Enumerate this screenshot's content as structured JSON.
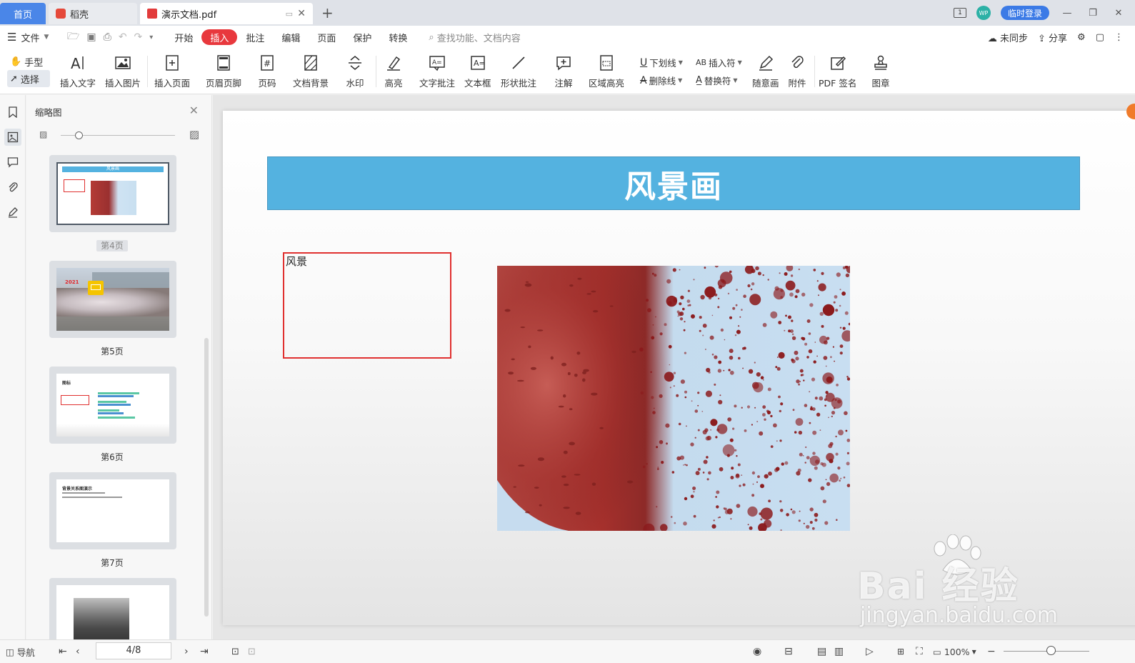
{
  "tabs": {
    "home": "首页",
    "daoke": "稻壳",
    "document": "演示文档.pdf",
    "new_tab": "+",
    "login": "临时登录",
    "avatar_text": "WP",
    "layout_icon_text": "1"
  },
  "menu": {
    "file": "文件",
    "items": [
      "开始",
      "插入",
      "批注",
      "编辑",
      "页面",
      "保护",
      "转换"
    ],
    "active": "插入",
    "search_placeholder": "查找功能、文档内容",
    "sync": "未同步",
    "share": "分享"
  },
  "ribbon": {
    "hand": "手型",
    "select": "选择",
    "insert_text": "插入文字",
    "insert_image": "插入图片",
    "insert_page": "插入页面",
    "header_footer": "页眉页脚",
    "page_number": "页码",
    "doc_background": "文档背景",
    "watermark": "水印",
    "highlight": "高亮",
    "text_comment": "文字批注",
    "text_box": "文本框",
    "shape_comment": "形状批注",
    "annotation": "注解",
    "area_highlight": "区域高亮",
    "underline": "下划线",
    "strikethrough": "删除线",
    "insert_symbol": "插入符",
    "replace_symbol": "替换符",
    "freehand": "随意画",
    "attachment": "附件",
    "pdf_sign": "PDF 签名",
    "stamp": "图章"
  },
  "thumbnails": {
    "title": "缩略图",
    "pages": [
      {
        "label": "第4页",
        "current": true
      },
      {
        "label": "第5页",
        "current": false
      },
      {
        "label": "第6页",
        "current": false
      },
      {
        "label": "第7页",
        "current": false
      }
    ],
    "page5_year": "2021",
    "page6_title": "图标",
    "page7_title": "背景关系图演示",
    "page4_banner": "风景画"
  },
  "document": {
    "banner_title": "风景画",
    "text_box_content": "风景"
  },
  "statusbar": {
    "nav": "导航",
    "page_indicator": "4/8",
    "zoom": "100%"
  },
  "watermark": {
    "brand": "Bai 经验",
    "url": "jingyan.baidu.com"
  },
  "colors": {
    "active_tab": "#e8383d",
    "home_tab": "#4a86e8",
    "banner": "#54b2e0",
    "text_box_border": "#e0302f",
    "login_button": "#3b7ae6"
  }
}
